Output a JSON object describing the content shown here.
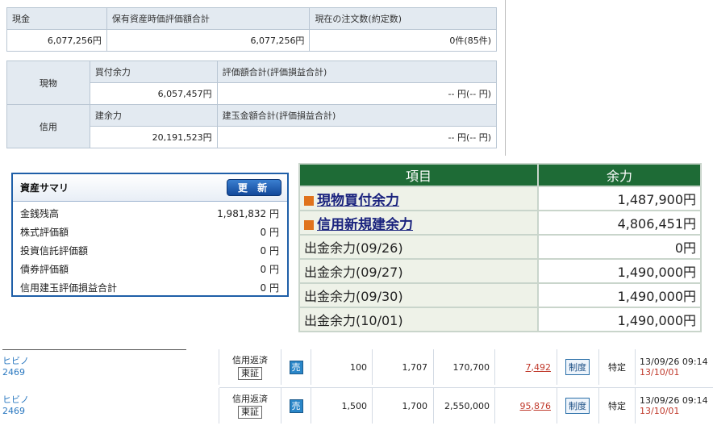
{
  "account": {
    "top_headers": [
      "現金",
      "保有資産時価評価額合計",
      "現在の注文数(約定数)"
    ],
    "top_values": [
      "6,077,256円",
      "6,077,256円",
      "0件(85件)"
    ],
    "genbutsu": {
      "label": "現物",
      "h1": "買付余力",
      "h2": "評価額合計(評価損益合計)",
      "v1": "6,057,457円",
      "v2": "-- 円(-- 円)"
    },
    "shinyou": {
      "label": "信用",
      "h1": "建余力",
      "h2": "建玉金額合計(評価損益合計)",
      "v1": "20,191,523円",
      "v2": "-- 円(-- 円)"
    }
  },
  "summary": {
    "title": "資産サマリ",
    "refresh_label": "更 新",
    "rows": [
      {
        "label": "金銭残高",
        "value": "1,981,832 円"
      },
      {
        "label": "株式評価額",
        "value": "0 円"
      },
      {
        "label": "投資信託評価額",
        "value": "0 円"
      },
      {
        "label": "債券評価額",
        "value": "0 円"
      },
      {
        "label": "信用建玉評価損益合計",
        "value": "0 円"
      }
    ]
  },
  "yoryoku": {
    "headers": [
      "項目",
      "余力"
    ],
    "rows": [
      {
        "label": "現物買付余力",
        "value": "1,487,900円",
        "link": true
      },
      {
        "label": "信用新規建余力",
        "value": "4,806,451円",
        "link": true
      },
      {
        "label": "出金余力(09/26)",
        "value": "0円",
        "link": false
      },
      {
        "label": "出金余力(09/27)",
        "value": "1,490,000円",
        "link": false
      },
      {
        "label": "出金余力(09/30)",
        "value": "1,490,000円",
        "link": false
      },
      {
        "label": "出金余力(10/01)",
        "value": "1,490,000円",
        "link": false
      }
    ],
    "accent_color": "#1e6b36",
    "marker_color": "#e0731c"
  },
  "orders": [
    {
      "name": "ヒビノ",
      "code": "2469",
      "type": "信用返済",
      "exchange": "東証",
      "side": "売",
      "qty": "100",
      "price": "1,707",
      "amount": "170,700",
      "pl": "7,492",
      "system": "制度",
      "account": "特定",
      "datetime": "13/09/26 09:14",
      "settle": "13/10/01"
    },
    {
      "name": "ヒビノ",
      "code": "2469",
      "type": "信用返済",
      "exchange": "東証",
      "side": "売",
      "qty": "1,500",
      "price": "1,700",
      "amount": "2,550,000",
      "pl": "95,876",
      "system": "制度",
      "account": "特定",
      "datetime": "13/09/26 09:14",
      "settle": "13/10/01"
    }
  ]
}
